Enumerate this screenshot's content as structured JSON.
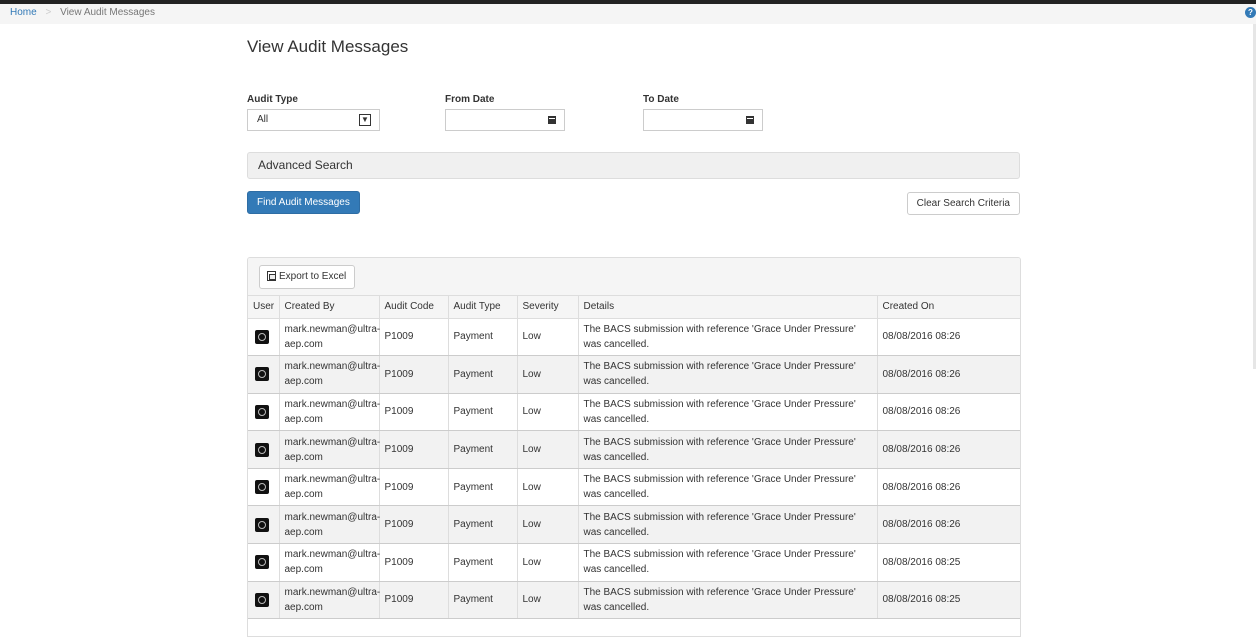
{
  "breadcrumb": {
    "home": "Home",
    "separator": ">",
    "current": "View Audit Messages"
  },
  "help_icon": "?",
  "page": {
    "title": "View Audit Messages"
  },
  "filters": {
    "audit_type_label": "Audit Type",
    "audit_type_value": "All",
    "from_date_label": "From Date",
    "from_date_value": "",
    "to_date_label": "To Date",
    "to_date_value": ""
  },
  "advanced_search_label": "Advanced Search",
  "buttons": {
    "find": "Find Audit Messages",
    "clear": "Clear Search Criteria",
    "export": "Export to Excel"
  },
  "table": {
    "headers": [
      "User",
      "Created By",
      "Audit Code",
      "Audit Type",
      "Severity",
      "Details",
      "Created On"
    ],
    "rows": [
      {
        "created_by_1": "mark.newman@ultra-",
        "created_by_2": "aep.com",
        "code": "P1009",
        "type": "Payment",
        "severity": "Low",
        "details": "The BACS submission with reference 'Grace Under Pressure' was cancelled.",
        "created_on": "08/08/2016 08:26"
      },
      {
        "created_by_1": "mark.newman@ultra-",
        "created_by_2": "aep.com",
        "code": "P1009",
        "type": "Payment",
        "severity": "Low",
        "details": "The BACS submission with reference 'Grace Under Pressure' was cancelled.",
        "created_on": "08/08/2016 08:26"
      },
      {
        "created_by_1": "mark.newman@ultra-",
        "created_by_2": "aep.com",
        "code": "P1009",
        "type": "Payment",
        "severity": "Low",
        "details": "The BACS submission with reference 'Grace Under Pressure' was cancelled.",
        "created_on": "08/08/2016 08:26"
      },
      {
        "created_by_1": "mark.newman@ultra-",
        "created_by_2": "aep.com",
        "code": "P1009",
        "type": "Payment",
        "severity": "Low",
        "details": "The BACS submission with reference 'Grace Under Pressure' was cancelled.",
        "created_on": "08/08/2016 08:26"
      },
      {
        "created_by_1": "mark.newman@ultra-",
        "created_by_2": "aep.com",
        "code": "P1009",
        "type": "Payment",
        "severity": "Low",
        "details": "The BACS submission with reference 'Grace Under Pressure' was cancelled.",
        "created_on": "08/08/2016 08:26"
      },
      {
        "created_by_1": "mark.newman@ultra-",
        "created_by_2": "aep.com",
        "code": "P1009",
        "type": "Payment",
        "severity": "Low",
        "details": "The BACS submission with reference 'Grace Under Pressure' was cancelled.",
        "created_on": "08/08/2016 08:26"
      },
      {
        "created_by_1": "mark.newman@ultra-",
        "created_by_2": "aep.com",
        "code": "P1009",
        "type": "Payment",
        "severity": "Low",
        "details": "The BACS submission with reference 'Grace Under Pressure' was cancelled.",
        "created_on": "08/08/2016 08:25"
      },
      {
        "created_by_1": "mark.newman@ultra-",
        "created_by_2": "aep.com",
        "code": "P1009",
        "type": "Payment",
        "severity": "Low",
        "details": "The BACS submission with reference 'Grace Under Pressure' was cancelled.",
        "created_on": "08/08/2016 08:25"
      }
    ]
  },
  "colors": {
    "primary": "#337ab7",
    "link": "#337ab7",
    "panel": "#f5f5f5"
  },
  "icons": {
    "calendar": "calendar-icon",
    "excel": "excel-icon",
    "user": "user-avatar-icon",
    "help": "help-icon"
  }
}
